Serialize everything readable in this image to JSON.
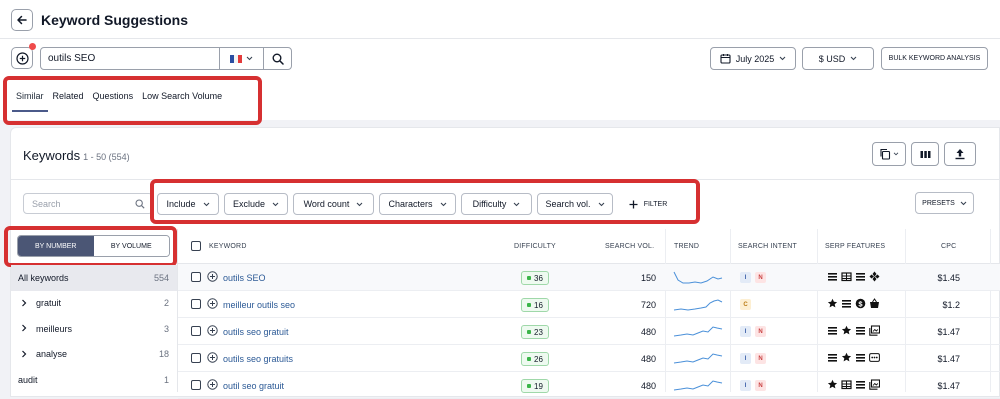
{
  "header": {
    "title": "Keyword Suggestions"
  },
  "search": {
    "query": "outils SEO",
    "country_flag": "fr"
  },
  "toolbar": {
    "date": "July 2025",
    "currency": "$ USD",
    "bulk_analysis": "BULK KEYWORD ANALYSIS"
  },
  "tabs": [
    "Similar",
    "Related",
    "Questions",
    "Low Search Volume"
  ],
  "keywords_panel": {
    "title": "Keywords",
    "range": "1 - 50 (554)"
  },
  "filters": {
    "search_placeholder": "Search",
    "buttons": [
      "Include",
      "Exclude",
      "Word count",
      "Characters",
      "Difficulty",
      "Search vol."
    ],
    "add_filter": "FILTER",
    "presets": "PRESETS"
  },
  "group_toggle": {
    "by_number": "BY NUMBER",
    "by_volume": "BY VOLUME"
  },
  "sidebar": {
    "items": [
      {
        "label": "All keywords",
        "count": "554"
      },
      {
        "label": "gratuit",
        "count": "2"
      },
      {
        "label": "meilleurs",
        "count": "3"
      },
      {
        "label": "analyse",
        "count": "18"
      },
      {
        "label": "audit",
        "count": "1"
      }
    ]
  },
  "table": {
    "headers": {
      "keyword": "KEYWORD",
      "difficulty": "DIFFICULTY",
      "search_vol": "SEARCH VOL.",
      "trend": "TREND",
      "intent": "SEARCH INTENT",
      "serp": "SERP FEATURES",
      "cpc": "CPC"
    },
    "rows": [
      {
        "keyword": "outils SEO",
        "difficulty": "36",
        "volume": "150",
        "intent": [
          "I",
          "N"
        ],
        "cpc": "$1.45"
      },
      {
        "keyword": "meilleur outils seo",
        "difficulty": "16",
        "volume": "720",
        "intent": [
          "C"
        ],
        "cpc": "$1.2"
      },
      {
        "keyword": "outils seo gratuit",
        "difficulty": "23",
        "volume": "480",
        "intent": [
          "I",
          "N"
        ],
        "cpc": "$1.47"
      },
      {
        "keyword": "outils seo gratuits",
        "difficulty": "26",
        "volume": "480",
        "intent": [
          "I",
          "N"
        ],
        "cpc": "$1.47"
      },
      {
        "keyword": "outil seo gratuit",
        "difficulty": "19",
        "volume": "480",
        "intent": [
          "I",
          "N"
        ],
        "cpc": "$1.47"
      }
    ]
  },
  "colors": {
    "accent": "#4b5675",
    "highlight_box": "#d63031",
    "link": "#2c5a96",
    "difficulty_green": "#3bb54a",
    "trend_line": "#4a90d9"
  }
}
